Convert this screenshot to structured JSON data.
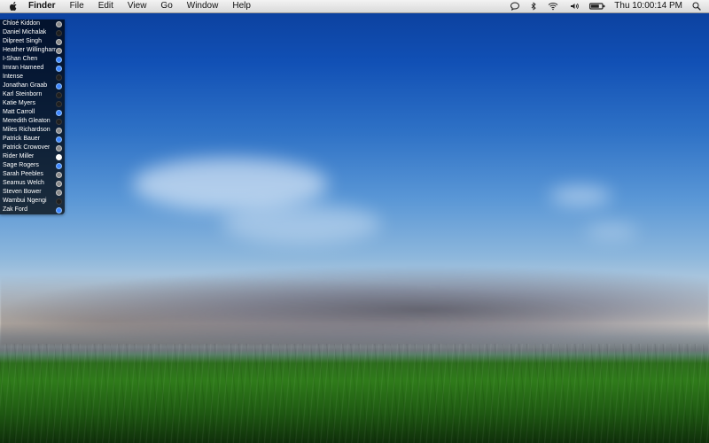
{
  "menubar": {
    "items": [
      "Finder",
      "File",
      "Edit",
      "View",
      "Go",
      "Window",
      "Help"
    ],
    "clock": "Thu 10:00:14 PM",
    "icons": [
      "apple-logo-icon",
      "speech-bubble-icon",
      "bluetooth-icon",
      "wifi-icon",
      "volume-icon",
      "battery-icon",
      "spotlight-search-icon"
    ]
  },
  "contacts": {
    "items": [
      {
        "name": "Chloé Kiddon",
        "status": "gray"
      },
      {
        "name": "Daniel Michalak",
        "status": "dark"
      },
      {
        "name": "Dilpreet Singh",
        "status": "gray"
      },
      {
        "name": "Heather Willingham",
        "status": "gray"
      },
      {
        "name": "I-Shan Chen",
        "status": "blue"
      },
      {
        "name": "Imran Hameed",
        "status": "blue"
      },
      {
        "name": "Intense",
        "status": "dark"
      },
      {
        "name": "Jonathan Graab",
        "status": "blue"
      },
      {
        "name": "Karl Steinborn",
        "status": "dark"
      },
      {
        "name": "Katie Myers",
        "status": "dark"
      },
      {
        "name": "Matt Carroll",
        "status": "blue"
      },
      {
        "name": "Meredith Gleaton",
        "status": "dark"
      },
      {
        "name": "Miles Richardson",
        "status": "gray"
      },
      {
        "name": "Patrick Bauer",
        "status": "blue"
      },
      {
        "name": "Patrick Crowover",
        "status": "gray"
      },
      {
        "name": "Rider Miller",
        "status": "white"
      },
      {
        "name": "Sage Rogers",
        "status": "blue"
      },
      {
        "name": "Sarah Peebles",
        "status": "gray"
      },
      {
        "name": "Seamus Welch",
        "status": "gray"
      },
      {
        "name": "Steven Bower",
        "status": "gray"
      },
      {
        "name": "Wambui Ngengi",
        "status": "dark"
      },
      {
        "name": "Zak Ford",
        "status": "blue"
      }
    ]
  }
}
